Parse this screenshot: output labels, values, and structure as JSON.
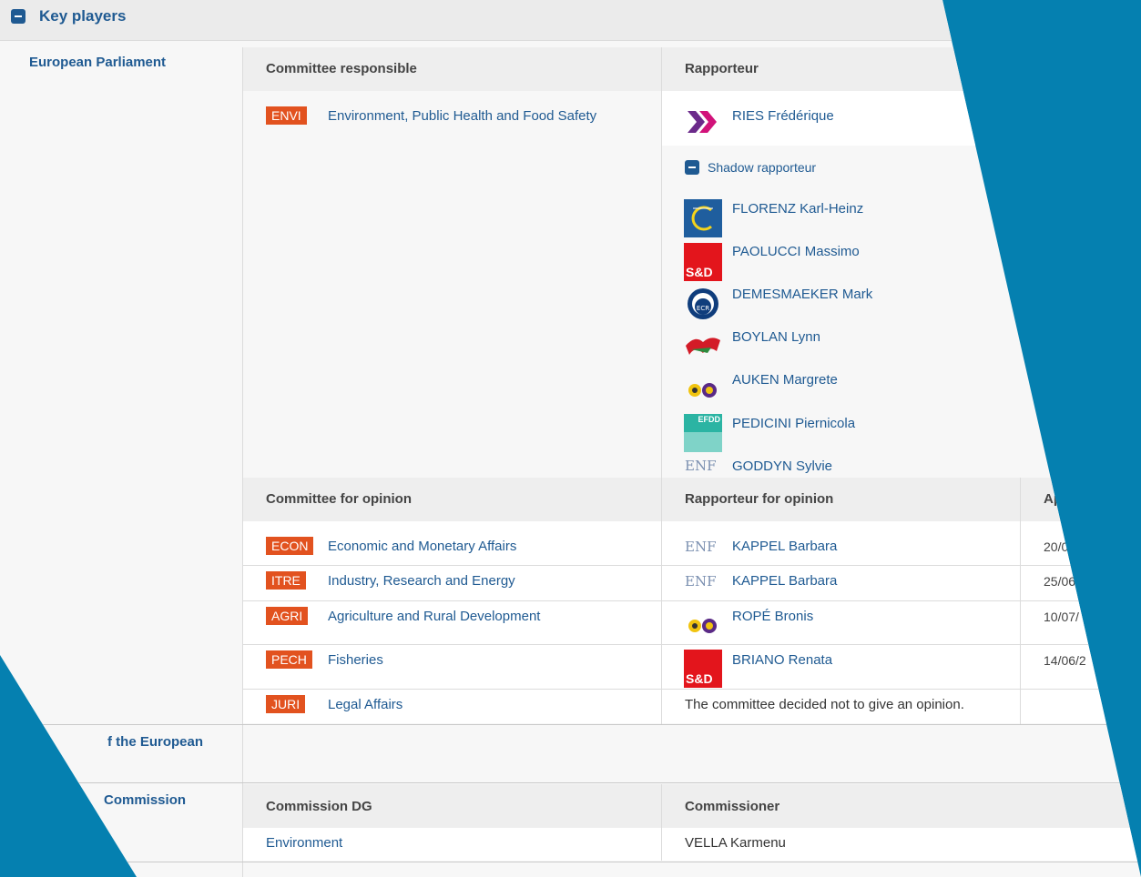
{
  "section": {
    "title": "Key players"
  },
  "sidebar": {
    "european_parliament": "European Parliament",
    "council": "f the European",
    "commission": "Commission",
    "bottom": "...  ..."
  },
  "headers": {
    "committee_responsible": "Committee responsible",
    "rapporteur": "Rapporteur",
    "committee_for_opinion": "Committee for opinion",
    "rapporteur_for_opinion": "Rapporteur for opinion",
    "appointed_partial": "Ap",
    "commission_dg": "Commission DG",
    "commissioner": "Commissioner"
  },
  "responsible": {
    "code": "ENVI",
    "name": "Environment, Public Health and Food Safety"
  },
  "rapporteur": {
    "name": "RIES Frédérique",
    "group_icon": "renew-europe-icon"
  },
  "shadow": {
    "label": "Shadow rapporteur",
    "members": [
      {
        "name": "FLORENZ Karl-Heinz",
        "group_icon": "epp-icon"
      },
      {
        "name": "PAOLUCCI Massimo",
        "group_icon": "sd-icon"
      },
      {
        "name": "DEMESMAEKER Mark",
        "group_icon": "ecr-icon"
      },
      {
        "name": "BOYLAN Lynn",
        "group_icon": "gue-icon"
      },
      {
        "name": "AUKEN Margrete",
        "group_icon": "greens-icon"
      },
      {
        "name": "PEDICINI Piernicola",
        "group_icon": "efdd-icon"
      },
      {
        "name": "GODDYN Sylvie",
        "group_icon": "enf-icon"
      }
    ]
  },
  "opinions": [
    {
      "code": "ECON",
      "name": "Economic and Monetary Affairs",
      "rapporteur": "KAPPEL Barbara",
      "date": "20/0",
      "group_icon": "enf-icon"
    },
    {
      "code": "ITRE",
      "name": "Industry, Research and Energy",
      "rapporteur": "KAPPEL Barbara",
      "date": "25/06",
      "group_icon": "enf-icon"
    },
    {
      "code": "AGRI",
      "name": "Agriculture and Rural Development",
      "rapporteur": "ROPÉ Bronis",
      "date": "10/07/",
      "group_icon": "greens-icon"
    },
    {
      "code": "PECH",
      "name": "Fisheries",
      "rapporteur": "BRIANO Renata",
      "date": "14/06/2",
      "group_icon": "sd-icon"
    },
    {
      "code": "JURI",
      "name": "Legal Affairs",
      "rapporteur": "The committee decided not to give an opinion.",
      "date": "",
      "group_icon": ""
    }
  ],
  "commission_row": {
    "dg": "Environment",
    "commissioner": "VELLA Karmenu"
  },
  "logo_text": {
    "sd": "S&D",
    "ecr": "ECR",
    "enf": "ENF",
    "efdd": "EFDD"
  },
  "colors": {
    "accent": "#1f5a92",
    "badge": "#e2521f",
    "background": "#0580b0"
  }
}
